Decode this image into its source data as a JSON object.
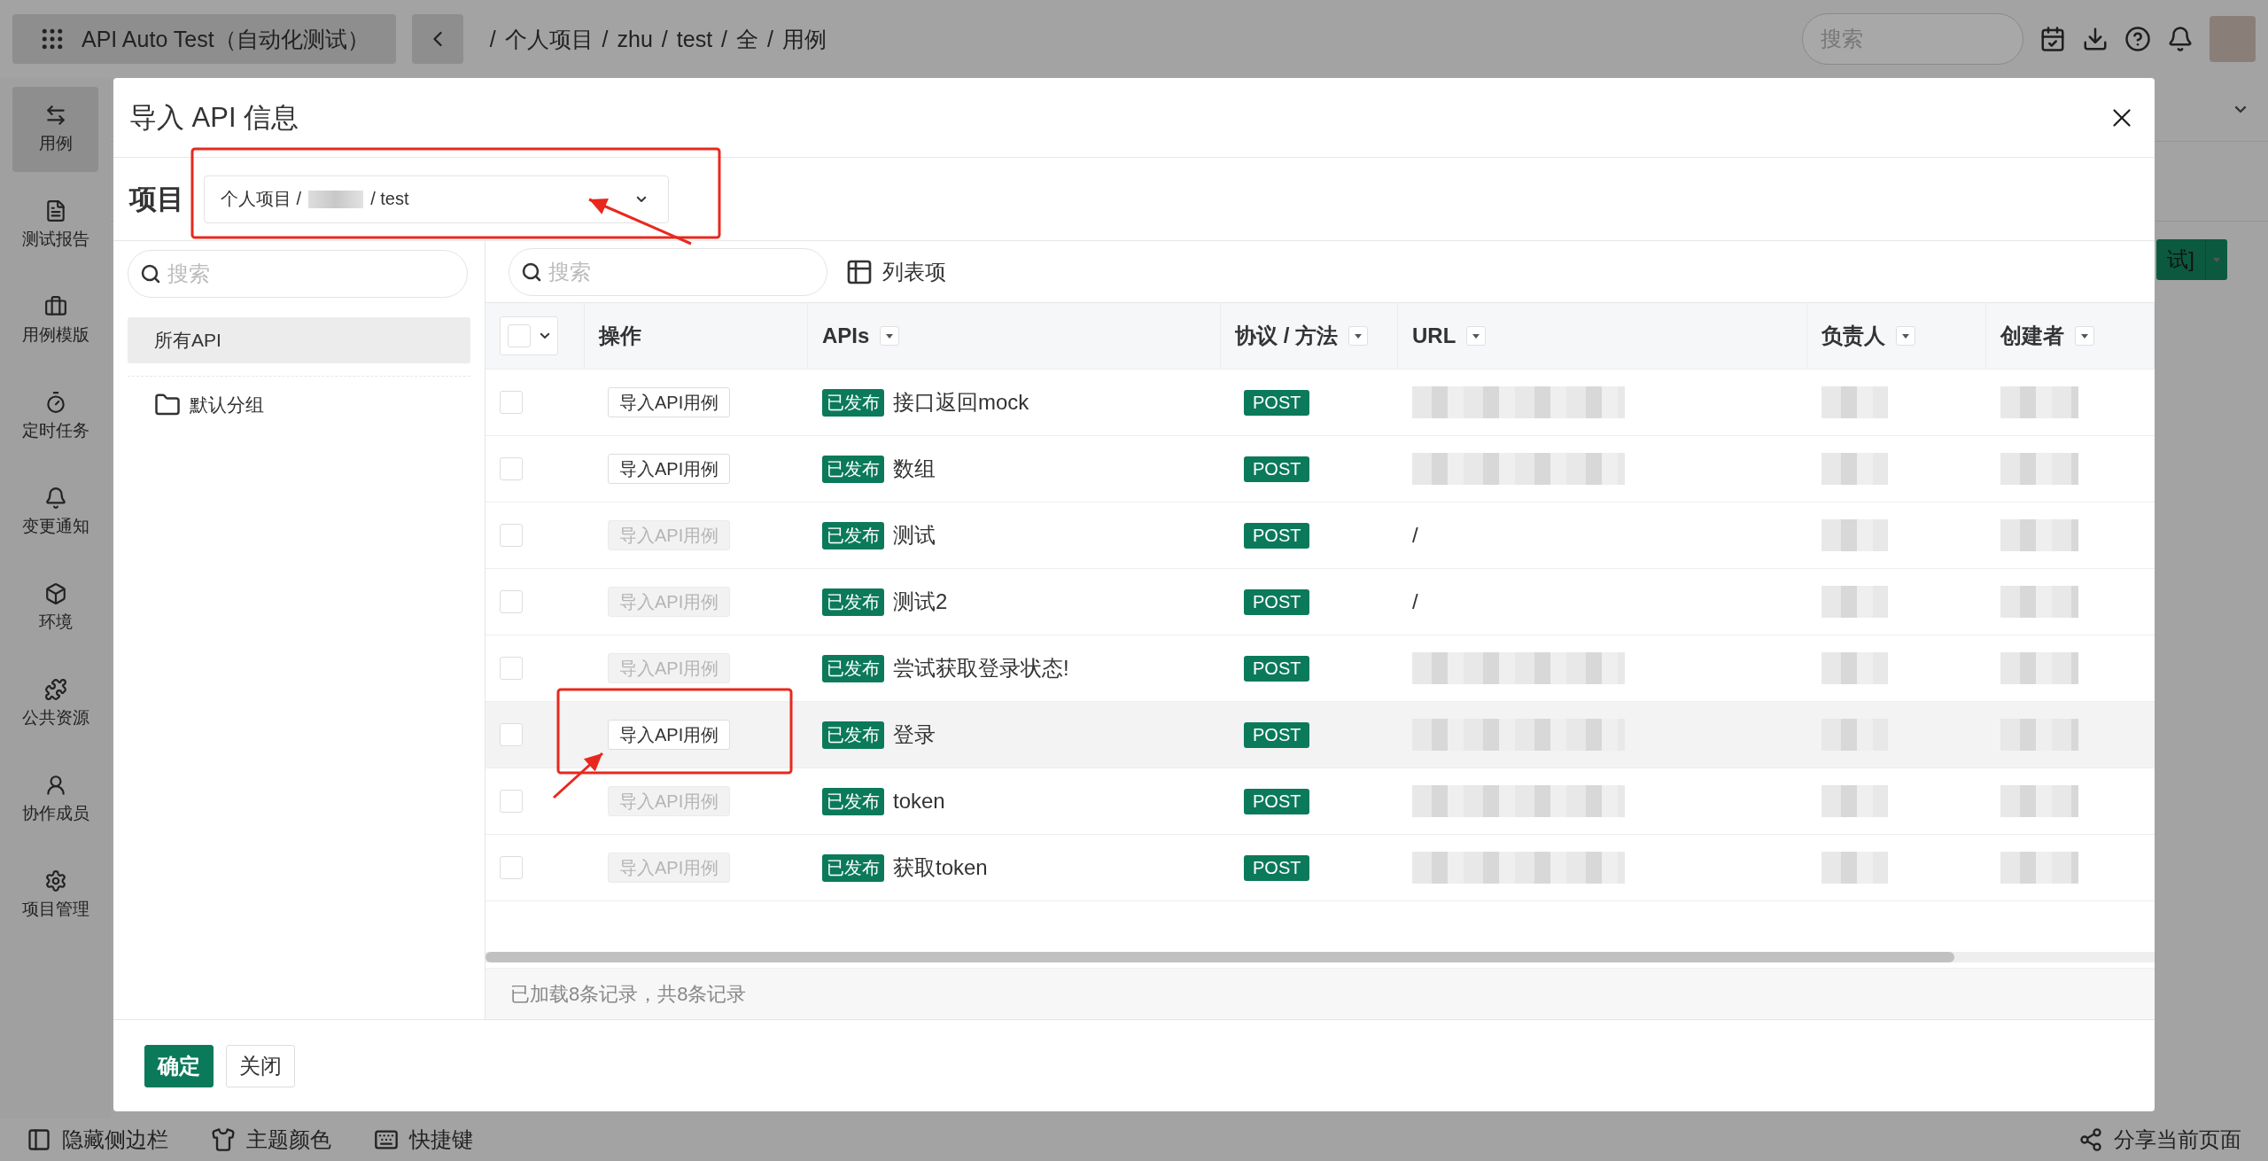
{
  "app": {
    "title": "API Auto Test（自动化测试）"
  },
  "breadcrumb": {
    "separator": "/",
    "items": [
      "个人项目",
      "zhu",
      "test",
      "全",
      "用例"
    ]
  },
  "header": {
    "search": {
      "placeholder": "搜索"
    }
  },
  "sidebar": {
    "items": [
      {
        "label": "用例",
        "selected": true
      },
      {
        "label": "测试报告",
        "selected": false
      },
      {
        "label": "用例模版",
        "selected": false
      },
      {
        "label": "定时任务",
        "selected": false
      },
      {
        "label": "变更通知",
        "selected": false
      },
      {
        "label": "环境",
        "selected": false
      },
      {
        "label": "公共资源",
        "selected": false
      },
      {
        "label": "协作成员",
        "selected": false
      },
      {
        "label": "项目管理",
        "selected": false
      }
    ]
  },
  "background": {
    "button_text": "试]"
  },
  "dialog": {
    "title": "导入 API 信息",
    "project": {
      "label": "项目",
      "prefix": "个人项目 /",
      "suffix": "/ test"
    },
    "tree": {
      "search": {
        "placeholder": "搜索"
      },
      "items": [
        {
          "kind": "all",
          "label": "所有API",
          "selected": true
        },
        {
          "kind": "folder",
          "label": "默认分组",
          "selected": false
        }
      ]
    },
    "toolbar": {
      "search": {
        "placeholder": "搜索"
      },
      "columns_button": "列表项"
    },
    "table": {
      "columns": [
        "操作",
        "APIs",
        "协议 / 方法",
        "URL",
        "负责人",
        "创建者"
      ],
      "rows": [
        {
          "checked": false,
          "highlighted": false,
          "action": "导入API用例",
          "action_disabled": false,
          "status": "已发布",
          "name": "接口返回mock",
          "method": "POST"
        },
        {
          "checked": false,
          "highlighted": false,
          "action": "导入API用例",
          "action_disabled": false,
          "status": "已发布",
          "name": "数组",
          "method": "POST"
        },
        {
          "checked": false,
          "highlighted": false,
          "action": "导入API用例",
          "action_disabled": true,
          "status": "已发布",
          "name": "测试",
          "method": "POST",
          "url": "/"
        },
        {
          "checked": false,
          "highlighted": false,
          "action": "导入API用例",
          "action_disabled": true,
          "status": "已发布",
          "name": "测试2",
          "method": "POST",
          "url": "/"
        },
        {
          "checked": false,
          "highlighted": false,
          "action": "导入API用例",
          "action_disabled": true,
          "status": "已发布",
          "name": "尝试获取登录状态!",
          "method": "POST"
        },
        {
          "checked": false,
          "highlighted": true,
          "action": "导入API用例",
          "action_disabled": false,
          "status": "已发布",
          "name": "登录",
          "method": "POST"
        },
        {
          "checked": false,
          "highlighted": false,
          "action": "导入API用例",
          "action_disabled": true,
          "status": "已发布",
          "name": "token",
          "method": "POST"
        },
        {
          "checked": false,
          "highlighted": false,
          "action": "导入API用例",
          "action_disabled": true,
          "status": "已发布",
          "name": "获取token",
          "method": "POST"
        }
      ]
    },
    "footer_text": "已加载8条记录，共8条记录",
    "buttons": [
      {
        "kind": "primary",
        "label": "确定"
      },
      {
        "kind": "default",
        "label": "关闭"
      }
    ]
  },
  "bottom_bar": {
    "left": [
      "隐藏侧边栏",
      "主题颜色",
      "快捷键"
    ],
    "right": "分享当前页面"
  }
}
